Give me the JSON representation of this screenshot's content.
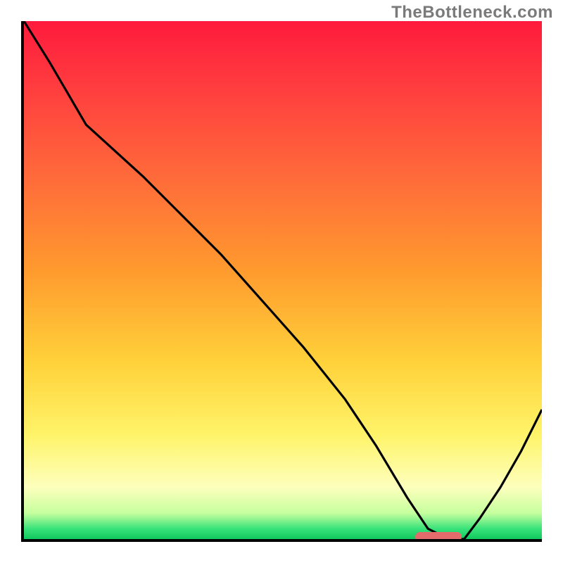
{
  "watermark": "TheBottleneck.com",
  "colors": {
    "gradient_top": "#ff1a3c",
    "gradient_mid_upper": "#ff9a2e",
    "gradient_mid_lower": "#fff46a",
    "gradient_bottom": "#10c95e",
    "axis": "#000000",
    "curve": "#000000",
    "marker": "#e36b6b"
  },
  "chart_data": {
    "type": "line",
    "title": "",
    "xlabel": "",
    "ylabel": "",
    "x": [
      0,
      5,
      12,
      23,
      30,
      38,
      46,
      54,
      62,
      68,
      74,
      78,
      82,
      85,
      88,
      92,
      96,
      100
    ],
    "y": [
      100,
      92,
      80,
      70,
      63,
      55,
      46,
      37,
      27,
      18,
      8,
      2,
      0,
      0,
      4,
      10,
      17,
      25
    ],
    "xlim": [
      0,
      100
    ],
    "ylim": [
      0,
      100
    ],
    "marker_x_range": [
      75.5,
      84.5
    ],
    "marker_y": 0
  }
}
